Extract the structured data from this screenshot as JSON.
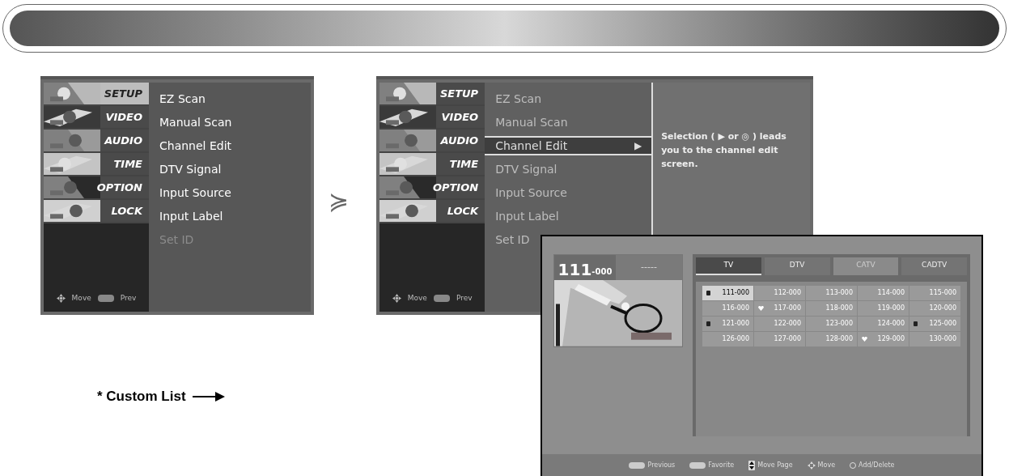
{
  "menu_left": {
    "active": true,
    "categories": [
      {
        "label": "SETUP",
        "selected": true
      },
      {
        "label": "VIDEO",
        "selected": false
      },
      {
        "label": "AUDIO",
        "selected": false
      },
      {
        "label": "TIME",
        "selected": false
      },
      {
        "label": "OPTION",
        "selected": false
      },
      {
        "label": "LOCK",
        "selected": false
      }
    ],
    "items": [
      {
        "label": "EZ Scan",
        "selected": false,
        "disabled": false
      },
      {
        "label": "Manual Scan",
        "selected": false,
        "disabled": false
      },
      {
        "label": "Channel Edit",
        "selected": false,
        "disabled": false
      },
      {
        "label": "DTV Signal",
        "selected": false,
        "disabled": false
      },
      {
        "label": "Input Source",
        "selected": false,
        "disabled": false
      },
      {
        "label": "Input Label",
        "selected": false,
        "disabled": false
      },
      {
        "label": "Set ID",
        "selected": false,
        "disabled": true
      }
    ],
    "hints": [
      "Move",
      "Prev"
    ]
  },
  "step_arrow": "≽",
  "menu_right": {
    "active": false,
    "categories": [
      {
        "label": "SETUP",
        "selected": false
      },
      {
        "label": "VIDEO",
        "selected": false
      },
      {
        "label": "AUDIO",
        "selected": false
      },
      {
        "label": "TIME",
        "selected": false
      },
      {
        "label": "OPTION",
        "selected": false
      },
      {
        "label": "LOCK",
        "selected": false
      }
    ],
    "items": [
      {
        "label": "EZ Scan",
        "selected": false,
        "disabled": false
      },
      {
        "label": "Manual Scan",
        "selected": false,
        "disabled": false
      },
      {
        "label": "Channel Edit",
        "selected": true,
        "disabled": false
      },
      {
        "label": "DTV Signal",
        "selected": false,
        "disabled": false
      },
      {
        "label": "Input Source",
        "selected": false,
        "disabled": false
      },
      {
        "label": "Input Label",
        "selected": false,
        "disabled": false
      },
      {
        "label": "Set ID",
        "selected": false,
        "disabled": false
      }
    ],
    "selected_arrow": "▶",
    "description": "Selection ( ▶ or ◎ ) leads you to the channel edit screen.",
    "hints": [
      "Move",
      "Prev"
    ]
  },
  "channel_edit": {
    "channel_number": "111",
    "channel_sub": "-000",
    "channel_name": "-----",
    "tabs": [
      {
        "label": "TV",
        "selected": true,
        "disabled": false
      },
      {
        "label": "DTV",
        "selected": false,
        "disabled": false
      },
      {
        "label": "CATV",
        "selected": false,
        "disabled": true
      },
      {
        "label": "CADTV",
        "selected": false,
        "disabled": false
      }
    ],
    "channels": [
      {
        "label": "111-000",
        "kind": "lock",
        "selected": true
      },
      {
        "label": "112-000",
        "kind": "plain",
        "selected": false
      },
      {
        "label": "113-000",
        "kind": "plain",
        "selected": false
      },
      {
        "label": "114-000",
        "kind": "plain",
        "selected": false
      },
      {
        "label": "115-000",
        "kind": "plain",
        "selected": false
      },
      {
        "label": "116-000",
        "kind": "plain",
        "selected": false
      },
      {
        "label": "117-000",
        "kind": "favorite",
        "selected": false
      },
      {
        "label": "118-000",
        "kind": "plain",
        "selected": false
      },
      {
        "label": "119-000",
        "kind": "plain",
        "selected": false
      },
      {
        "label": "120-000",
        "kind": "plain",
        "selected": false
      },
      {
        "label": "121-000",
        "kind": "lock",
        "selected": false
      },
      {
        "label": "122-000",
        "kind": "plain",
        "selected": false
      },
      {
        "label": "123-000",
        "kind": "plain",
        "selected": false
      },
      {
        "label": "124-000",
        "kind": "plain",
        "selected": false
      },
      {
        "label": "125-000",
        "kind": "lock",
        "selected": false
      },
      {
        "label": "126-000",
        "kind": "plain",
        "selected": false
      },
      {
        "label": "127-000",
        "kind": "plain",
        "selected": false
      },
      {
        "label": "128-000",
        "kind": "plain",
        "selected": false
      },
      {
        "label": "129-000",
        "kind": "favorite",
        "selected": false
      },
      {
        "label": "130-000",
        "kind": "plain",
        "selected": false
      }
    ],
    "footer": [
      {
        "label": "Previous",
        "kind": "key"
      },
      {
        "label": "Favorite",
        "kind": "key"
      },
      {
        "label": "Move Page",
        "kind": "updown"
      },
      {
        "label": "Move",
        "kind": "dpad"
      },
      {
        "label": "Add/Delete",
        "kind": "ok"
      }
    ]
  },
  "callout": {
    "label": "* Custom List"
  }
}
